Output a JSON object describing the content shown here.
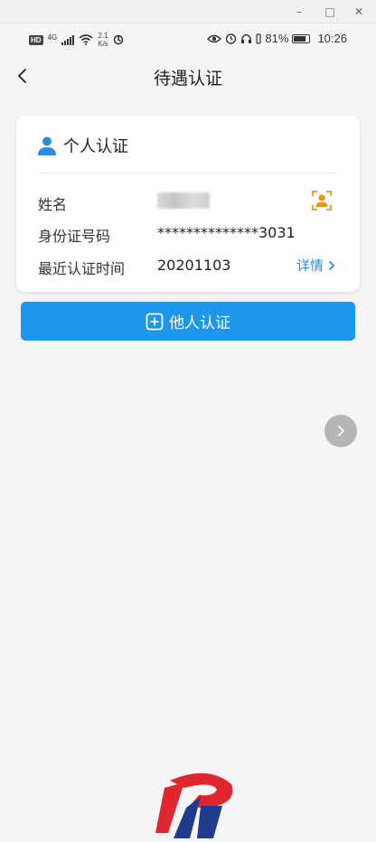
{
  "window": {
    "minimize": "–",
    "maximize": "□",
    "close": "✕"
  },
  "status_bar": {
    "hd": "HD",
    "network": "4G",
    "speed_value": "2.1",
    "speed_unit": "K/s",
    "battery": "81%",
    "time": "10:26",
    "icons": [
      "signal-icon",
      "wifi-icon",
      "data-sync-icon",
      "eye-icon",
      "alarm-icon",
      "headphones-icon",
      "battery-icon"
    ]
  },
  "header": {
    "title": "待遇认证",
    "back_icon": "chevron-left-icon"
  },
  "personal_card": {
    "title": "个人认证",
    "title_icon": "person-icon",
    "rows": {
      "name_label": "姓名",
      "id_label": "身份证号码",
      "id_value": "**************3031",
      "recent_label": "最近认证时间",
      "recent_value": "20201103"
    },
    "face_icon": "face-scan-icon",
    "detail_link": "详情"
  },
  "other_button": {
    "label": "他人认证",
    "icon": "plus-square-icon"
  },
  "float_button": {
    "icon": "chevron-right-icon"
  },
  "colors": {
    "accent": "#1e96ec",
    "link": "#2a8ce0",
    "person_icon": "#2a8ce0",
    "face_icon": "#e89320",
    "float_button": "#b5b5b5",
    "logo_red": "#e0262e",
    "logo_blue": "#1f3d8c"
  },
  "logo": {
    "icon": "company-logo-icon"
  }
}
